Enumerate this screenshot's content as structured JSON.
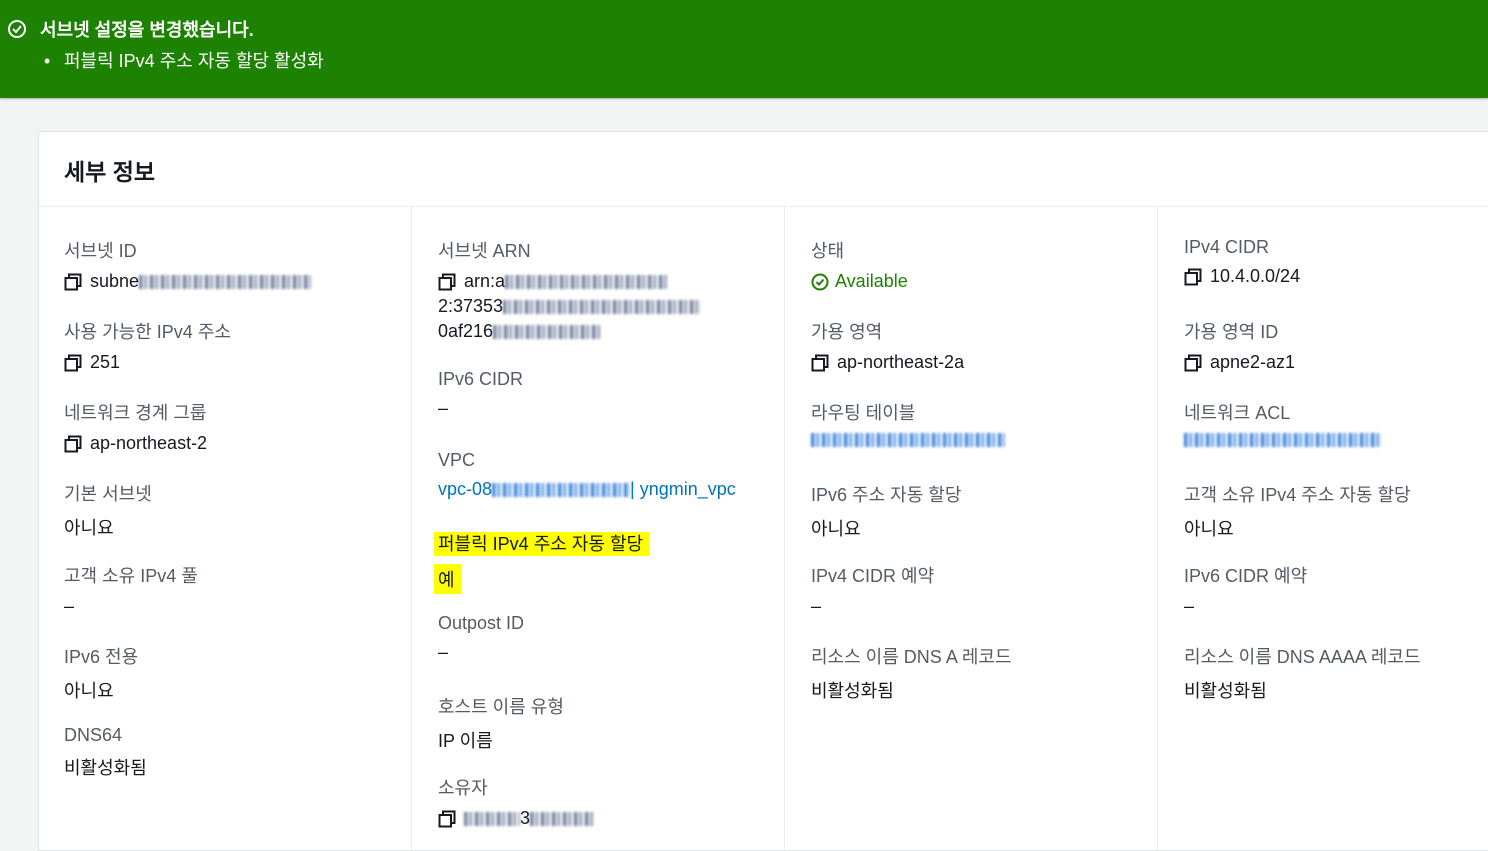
{
  "flash": {
    "title": "서브넷 설정을 변경했습니다.",
    "items": [
      "퍼블릭 IPv4 주소 자동 할당 활성화"
    ],
    "bullet": "•"
  },
  "panel": {
    "title": "세부 정보"
  },
  "col1": {
    "subnet_id_label": "서브넷 ID",
    "subnet_id_value": "subne",
    "available_ipv4_label": "사용 가능한 IPv4 주소",
    "available_ipv4_value": "251",
    "network_border_label": "네트워크 경계 그룹",
    "network_border_value": "ap-northeast-2",
    "default_subnet_label": "기본 서브넷",
    "default_subnet_value": "아니요",
    "customer_pool_label": "고객 소유 IPv4 풀",
    "customer_pool_value": "–",
    "ipv6_only_label": "IPv6 전용",
    "ipv6_only_value": "아니요",
    "dns64_label": "DNS64",
    "dns64_value": "비활성화됨"
  },
  "col2": {
    "arn_label": "서브넷 ARN",
    "arn_line1": "arn:a",
    "arn_line2": "2:37353",
    "arn_line3": "0af216",
    "ipv6_cidr_label": "IPv6 CIDR",
    "ipv6_cidr_value": "–",
    "vpc_label": "VPC",
    "vpc_prefix": "vpc-08",
    "vpc_name": " | yngmin_vpc",
    "public_ipv4_label": "퍼블릭 IPv4 주소 자동 할당",
    "public_ipv4_value": "예",
    "outpost_label": "Outpost ID",
    "outpost_value": "–",
    "hostname_type_label": "호스트 이름 유형",
    "hostname_type_value": "IP 이름",
    "owner_label": "소유자",
    "owner_value": "3"
  },
  "col3": {
    "state_label": "상태",
    "state_value": "Available",
    "az_label": "가용 영역",
    "az_value": "ap-northeast-2a",
    "route_table_label": "라우팅 테이블",
    "ipv6_auto_label": "IPv6 주소 자동 할당",
    "ipv6_auto_value": "아니요",
    "ipv4_cidr_reservation_label": "IPv4 CIDR 예약",
    "ipv4_cidr_reservation_value": "–",
    "dns_a_label": "리소스 이름 DNS A 레코드",
    "dns_a_value": "비활성화됨"
  },
  "col4": {
    "ipv4_cidr_label": "IPv4 CIDR",
    "ipv4_cidr_value": "10.4.0.0/24",
    "az_id_label": "가용 영역 ID",
    "az_id_value": "apne2-az1",
    "network_acl_label": "네트워크 ACL",
    "customer_ipv4_auto_label": "고객 소유 IPv4 주소 자동 할당",
    "customer_ipv4_auto_value": "아니요",
    "ipv6_cidr_reservation_label": "IPv6 CIDR 예약",
    "ipv6_cidr_reservation_value": "–",
    "dns_aaaa_label": "리소스 이름 DNS AAAA 레코드",
    "dns_aaaa_value": "비활성화됨"
  },
  "colors": {
    "flash_bg": "#1d8102",
    "link": "#0073bb",
    "status_ok": "#1d8102",
    "highlight": "#ffff00"
  },
  "icons": [
    "success-circle-icon",
    "copy-icon",
    "status-check-icon"
  ]
}
